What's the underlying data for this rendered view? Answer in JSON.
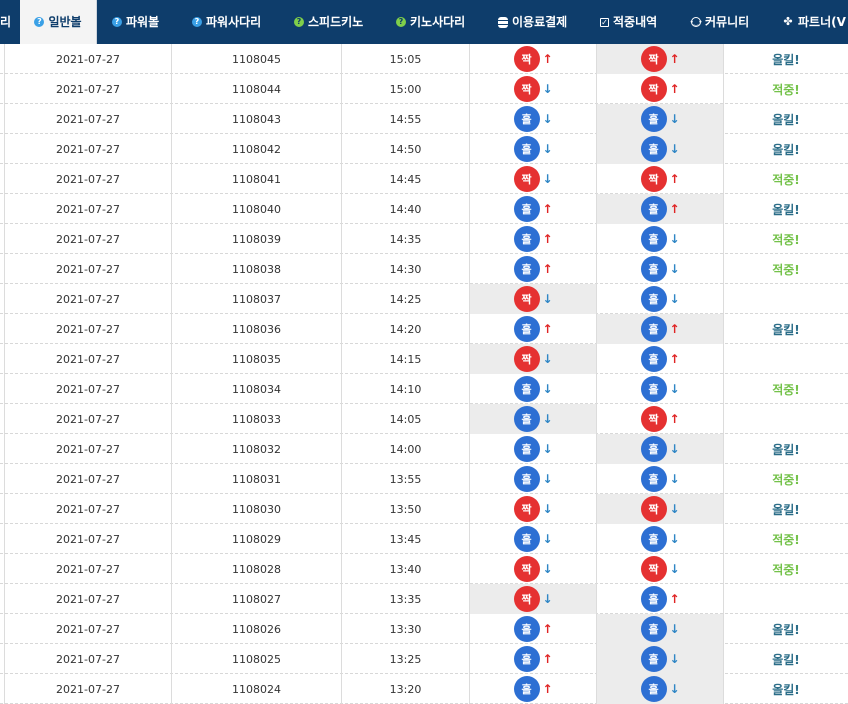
{
  "nav": {
    "items": [
      {
        "label": "리",
        "icon": "none"
      },
      {
        "label": "일반볼",
        "icon": "question-icon",
        "active": true
      },
      {
        "label": "파워볼",
        "icon": "question-icon"
      },
      {
        "label": "파워사다리",
        "icon": "question-icon"
      },
      {
        "label": "스피드키노",
        "icon": "question-icon"
      },
      {
        "label": "키노사다리",
        "icon": "question-icon"
      },
      {
        "label": "이용료결제",
        "icon": "database-icon"
      },
      {
        "label": "적중내역",
        "icon": "check-square-icon"
      },
      {
        "label": "커뮤니티",
        "icon": "smile-icon"
      },
      {
        "label": "파트너(V",
        "icon": "cubes-icon"
      }
    ]
  },
  "colors": {
    "nav_bg": "#0e3d6b",
    "odd": "#2d6fd3",
    "even": "#e53131",
    "up": "#e02424",
    "down": "#2f86c5",
    "hit": "#74c24a",
    "fail": "#2b6d88"
  },
  "rows": [
    {
      "date": "2021-07-27",
      "round": "1108045",
      "time": "15:05",
      "p1": "짝",
      "d1": "↑",
      "p2": "짝",
      "d2": "↑",
      "result": "올킬!"
    },
    {
      "date": "2021-07-27",
      "round": "1108044",
      "time": "15:00",
      "p1": "짝",
      "d1": "↓",
      "p2": "짝",
      "d2": "↑",
      "result": "적중!"
    },
    {
      "date": "2021-07-27",
      "round": "1108043",
      "time": "14:55",
      "p1": "홀",
      "d1": "↓",
      "p2": "홀",
      "d2": "↓",
      "result": "올킬!"
    },
    {
      "date": "2021-07-27",
      "round": "1108042",
      "time": "14:50",
      "p1": "홀",
      "d1": "↓",
      "p2": "홀",
      "d2": "↓",
      "result": "올킬!"
    },
    {
      "date": "2021-07-27",
      "round": "1108041",
      "time": "14:45",
      "p1": "짝",
      "d1": "↓",
      "p2": "짝",
      "d2": "↑",
      "result": "적중!"
    },
    {
      "date": "2021-07-27",
      "round": "1108040",
      "time": "14:40",
      "p1": "홀",
      "d1": "↑",
      "p2": "홀",
      "d2": "↑",
      "result": "올킬!"
    },
    {
      "date": "2021-07-27",
      "round": "1108039",
      "time": "14:35",
      "p1": "홀",
      "d1": "↑",
      "p2": "홀",
      "d2": "↓",
      "result": "적중!"
    },
    {
      "date": "2021-07-27",
      "round": "1108038",
      "time": "14:30",
      "p1": "홀",
      "d1": "↑",
      "p2": "홀",
      "d2": "↓",
      "result": "적중!"
    },
    {
      "date": "2021-07-27",
      "round": "1108037",
      "time": "14:25",
      "p1": "짝",
      "d1": "↓",
      "p2": "홀",
      "d2": "↓",
      "result": ""
    },
    {
      "date": "2021-07-27",
      "round": "1108036",
      "time": "14:20",
      "p1": "홀",
      "d1": "↑",
      "p2": "홀",
      "d2": "↑",
      "result": "올킬!"
    },
    {
      "date": "2021-07-27",
      "round": "1108035",
      "time": "14:15",
      "p1": "짝",
      "d1": "↓",
      "p2": "홀",
      "d2": "↑",
      "result": ""
    },
    {
      "date": "2021-07-27",
      "round": "1108034",
      "time": "14:10",
      "p1": "홀",
      "d1": "↓",
      "p2": "홀",
      "d2": "↓",
      "result": "적중!"
    },
    {
      "date": "2021-07-27",
      "round": "1108033",
      "time": "14:05",
      "p1": "홀",
      "d1": "↓",
      "p2": "짝",
      "d2": "↑",
      "result": ""
    },
    {
      "date": "2021-07-27",
      "round": "1108032",
      "time": "14:00",
      "p1": "홀",
      "d1": "↓",
      "p2": "홀",
      "d2": "↓",
      "result": "올킬!"
    },
    {
      "date": "2021-07-27",
      "round": "1108031",
      "time": "13:55",
      "p1": "홀",
      "d1": "↓",
      "p2": "홀",
      "d2": "↓",
      "result": "적중!"
    },
    {
      "date": "2021-07-27",
      "round": "1108030",
      "time": "13:50",
      "p1": "짝",
      "d1": "↓",
      "p2": "짝",
      "d2": "↓",
      "result": "올킬!"
    },
    {
      "date": "2021-07-27",
      "round": "1108029",
      "time": "13:45",
      "p1": "홀",
      "d1": "↓",
      "p2": "홀",
      "d2": "↓",
      "result": "적중!"
    },
    {
      "date": "2021-07-27",
      "round": "1108028",
      "time": "13:40",
      "p1": "짝",
      "d1": "↓",
      "p2": "짝",
      "d2": "↓",
      "result": "적중!"
    },
    {
      "date": "2021-07-27",
      "round": "1108027",
      "time": "13:35",
      "p1": "짝",
      "d1": "↓",
      "p2": "홀",
      "d2": "↑",
      "result": ""
    },
    {
      "date": "2021-07-27",
      "round": "1108026",
      "time": "13:30",
      "p1": "홀",
      "d1": "↑",
      "p2": "홀",
      "d2": "↓",
      "result": "올킬!"
    },
    {
      "date": "2021-07-27",
      "round": "1108025",
      "time": "13:25",
      "p1": "홀",
      "d1": "↑",
      "p2": "홀",
      "d2": "↓",
      "result": "올킬!"
    },
    {
      "date": "2021-07-27",
      "round": "1108024",
      "time": "13:20",
      "p1": "홀",
      "d1": "↑",
      "p2": "홀",
      "d2": "↓",
      "result": "올킬!"
    }
  ]
}
